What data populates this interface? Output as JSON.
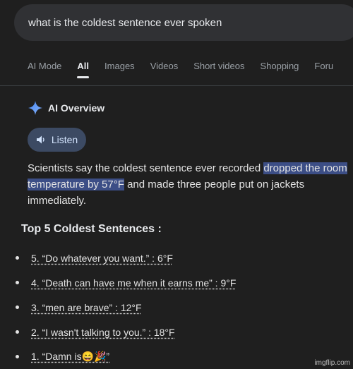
{
  "search": {
    "query": "what is the coldest sentence ever spoken"
  },
  "tabs": [
    {
      "label": "AI Mode",
      "active": false
    },
    {
      "label": "All",
      "active": true
    },
    {
      "label": "Images",
      "active": false
    },
    {
      "label": "Videos",
      "active": false
    },
    {
      "label": "Short videos",
      "active": false
    },
    {
      "label": "Shopping",
      "active": false
    },
    {
      "label": "Foru",
      "active": false
    }
  ],
  "ai_overview": {
    "title": "AI Overview",
    "listen_label": "Listen",
    "text_before": "Scientists say the coldest sentence ever recorded ",
    "text_highlight": "dropped the room temperature by 57°F",
    "text_after": " and made three people put on jackets immediately.",
    "list_title": "Top 5 Coldest Sentences :",
    "list_items": [
      "5. “Do whatever you want.” : 6°F",
      "4. “Death can have me when it earns me” : 9°F",
      "3. “men are brave” : 12°F",
      "2. “I wasn't talking to you.” : 18°F",
      "1. “Damn is😄🎉”"
    ]
  },
  "watermark": "imgflip.com",
  "colors": {
    "background": "#1f1f1f",
    "search_bg": "#303134",
    "listen_bg": "#3c4a63",
    "highlight": "#3c4e86",
    "accent": "#4285f4"
  }
}
